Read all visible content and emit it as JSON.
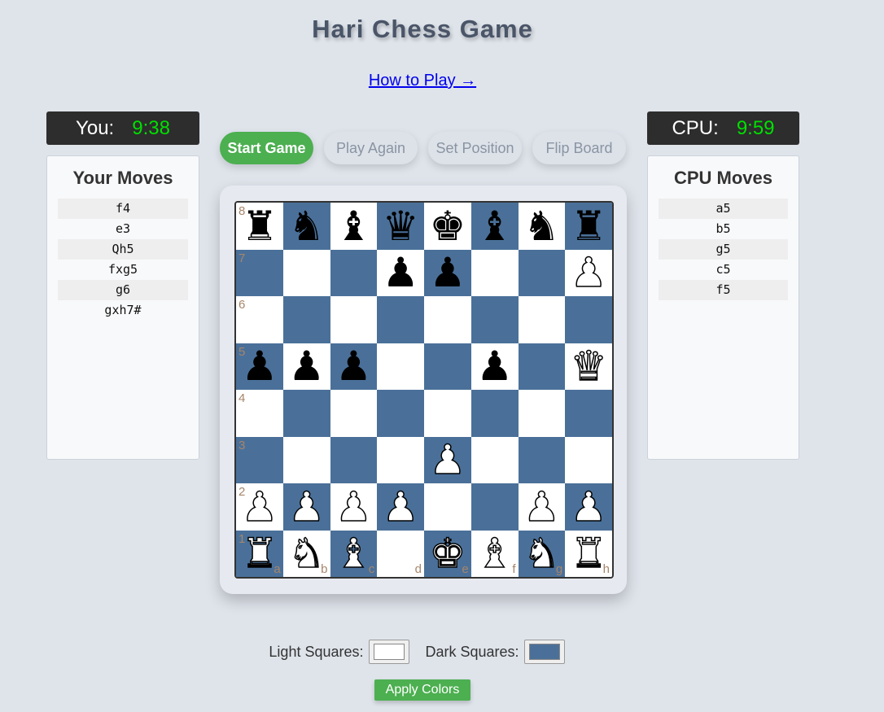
{
  "header": {
    "title": "Hari Chess Game",
    "how_to_play": "How to Play →"
  },
  "player": {
    "label": "You:",
    "time": "9:38"
  },
  "cpu": {
    "label": "CPU:",
    "time": "9:59"
  },
  "your_moves": {
    "title": "Your Moves",
    "items": [
      "f4",
      "e3",
      "Qh5",
      "fxg5",
      "g6",
      "gxh7#"
    ]
  },
  "cpu_moves": {
    "title": "CPU Moves",
    "items": [
      "a5",
      "b5",
      "g5",
      "c5",
      "f5"
    ]
  },
  "buttons": {
    "start": "Start Game",
    "play_again": "Play Again",
    "set_position": "Set Position",
    "flip_board": "Flip Board",
    "apply": "Apply Colors"
  },
  "colors": {
    "light_label": "Light Squares:",
    "dark_label": "Dark Squares:",
    "light": "#ffffff",
    "dark": "#4a7099"
  },
  "board": {
    "ranks": [
      "8",
      "7",
      "6",
      "5",
      "4",
      "3",
      "2",
      "1"
    ],
    "files": [
      "a",
      "b",
      "c",
      "d",
      "e",
      "f",
      "g",
      "h"
    ],
    "rows": [
      [
        "br",
        "bn",
        "bb",
        "bq",
        "bk",
        "bb",
        "bn",
        "br"
      ],
      [
        "",
        "",
        "",
        "bp",
        "bp",
        "",
        "",
        "wp"
      ],
      [
        "",
        "",
        "",
        "",
        "",
        "",
        "",
        ""
      ],
      [
        "bp",
        "bp",
        "bp",
        "",
        "",
        "bp",
        "",
        "wq"
      ],
      [
        "",
        "",
        "",
        "",
        "",
        "",
        "",
        ""
      ],
      [
        "",
        "",
        "",
        "",
        "wp",
        "",
        "",
        ""
      ],
      [
        "wp",
        "wp",
        "wp",
        "wp",
        "",
        "",
        "wp",
        "wp"
      ],
      [
        "wr",
        "wn",
        "wb",
        "",
        "wk",
        "wb",
        "wn",
        "wr"
      ]
    ]
  }
}
